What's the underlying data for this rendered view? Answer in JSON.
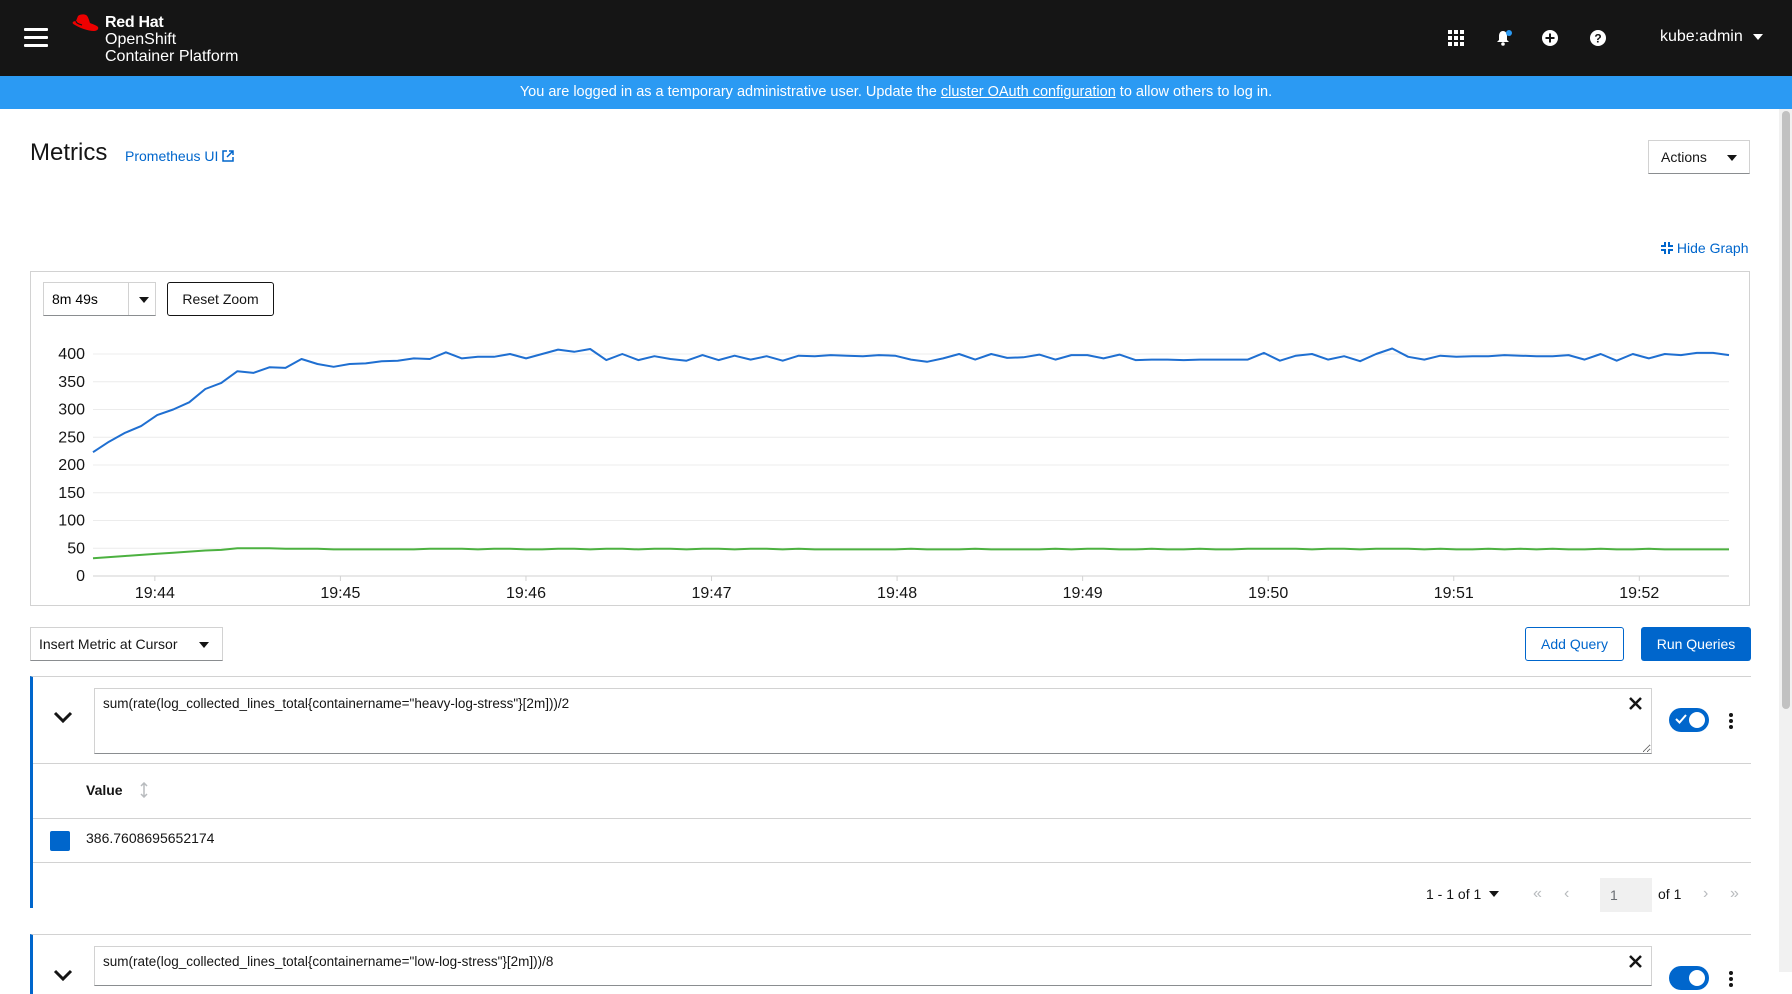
{
  "masthead": {
    "brand_line1": "Red Hat",
    "brand_line2": "OpenShift",
    "brand_line3": "Container Platform",
    "user": "kube:admin",
    "icons": [
      "grid-icon",
      "bell-icon",
      "plus-circle-icon",
      "help-icon"
    ]
  },
  "banner": {
    "prefix": "You are logged in as a temporary administrative user. Update the ",
    "link": "cluster OAuth configuration",
    "suffix": " to allow others to log in."
  },
  "page": {
    "title": "Metrics",
    "prometheus_link": "Prometheus UI",
    "actions_label": "Actions",
    "hide_graph_label": "Hide Graph"
  },
  "graph": {
    "timespan": "8m 49s",
    "reset_zoom_label": "Reset Zoom"
  },
  "chart_data": {
    "type": "line",
    "ylim": [
      0,
      400
    ],
    "yticks": [
      0,
      50,
      100,
      150,
      200,
      250,
      300,
      350,
      400
    ],
    "xticks": [
      "19:44",
      "19:45",
      "19:46",
      "19:47",
      "19:48",
      "19:49",
      "19:50",
      "19:51",
      "19:52"
    ],
    "x_start": "19:43:40",
    "x_end": "19:52:29",
    "grid": true,
    "series": [
      {
        "color": "#1f6fd1",
        "values": [
          223,
          242,
          258,
          270,
          290,
          300,
          313,
          337,
          348,
          369,
          366,
          376,
          375,
          391,
          382,
          377,
          382,
          383,
          387,
          388,
          392,
          391,
          403,
          392,
          395,
          395,
          400,
          392,
          400,
          408,
          404,
          409,
          389,
          400,
          389,
          396,
          391,
          388,
          398,
          389,
          397,
          390,
          396,
          388,
          397,
          396,
          398,
          397,
          396,
          398,
          397,
          390,
          386,
          392,
          400,
          390,
          400,
          393,
          394,
          399,
          390,
          398,
          398,
          392,
          399,
          389,
          390,
          390,
          389,
          390,
          390,
          390,
          390,
          402,
          388,
          397,
          400,
          390,
          396,
          387,
          400,
          410,
          395,
          390,
          397,
          395,
          396,
          396,
          398,
          397,
          396,
          396,
          398,
          390,
          400,
          388,
          400,
          392,
          400,
          398,
          402,
          402,
          398
        ]
      },
      {
        "color": "#4cb140",
        "values": [
          32,
          34,
          36,
          38,
          40,
          42,
          44,
          46,
          47,
          50,
          50,
          50,
          49,
          49,
          49,
          48,
          48,
          48,
          48,
          48,
          48,
          49,
          49,
          49,
          48,
          49,
          49,
          48,
          48,
          49,
          49,
          48,
          49,
          49,
          48,
          49,
          49,
          48,
          49,
          49,
          48,
          49,
          49,
          48,
          49,
          48,
          48,
          48,
          48,
          48,
          48,
          49,
          48,
          48,
          48,
          49,
          48,
          48,
          48,
          48,
          49,
          48,
          49,
          49,
          48,
          48,
          49,
          48,
          48,
          49,
          48,
          48,
          49,
          49,
          49,
          49,
          48,
          49,
          49,
          48,
          49,
          49,
          49,
          48,
          49,
          48,
          48,
          49,
          48,
          49,
          48,
          49,
          48,
          48,
          49,
          48,
          48,
          49,
          48,
          48,
          48,
          48,
          48
        ]
      }
    ]
  },
  "query_controls": {
    "insert_metric_label": "Insert Metric at Cursor",
    "add_query_label": "Add Query",
    "run_queries_label": "Run Queries"
  },
  "queries": [
    {
      "expression": "sum(rate(log_collected_lines_total{containername=\"heavy-log-stress\"}[2m]))/2",
      "enabled": true,
      "table_header": "Value",
      "rows": [
        {
          "swatch_color": "#0066cc",
          "value": "386.7608695652174"
        }
      ],
      "pagination": {
        "range_label": "1 - 1 of 1",
        "page": "1",
        "of_label": "of 1"
      }
    },
    {
      "expression": "sum(rate(log_collected_lines_total{containername=\"low-log-stress\"}[2m]))/8",
      "enabled": true
    }
  ],
  "colors": {
    "masthead_bg": "#151515",
    "banner_bg": "#2b9af3",
    "accent": "#0066cc"
  }
}
